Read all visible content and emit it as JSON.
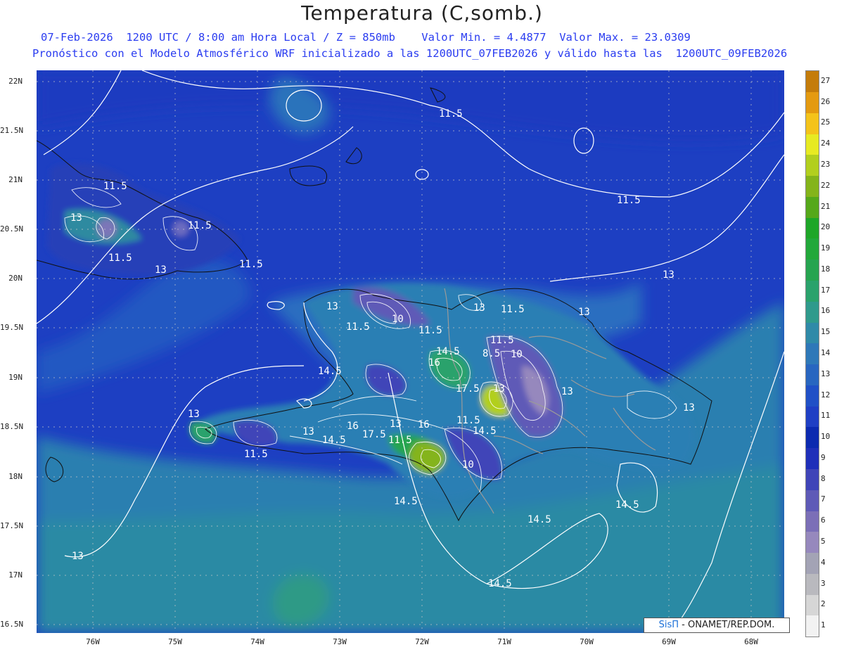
{
  "header": {
    "title": "Temperatura (C,somb.)",
    "line1": "07-Feb-2026  1200 UTC / 8:00 am Hora Local / Z = 850mb    Valor Min. = 4.4877  Valor Max. = 23.0309",
    "line2": "Pronóstico con el Modelo Atmosférico WRF inicializado a las 1200UTC_07FEB2026 y válido hasta las  1200UTC_09FEB2026"
  },
  "axes": {
    "lat_labels": [
      "22N",
      "21.5N",
      "21N",
      "20.5N",
      "20N",
      "19.5N",
      "19N",
      "18.5N",
      "18N",
      "17.5N",
      "17N",
      "16.5N"
    ],
    "lon_labels": [
      "76W",
      "75W",
      "74W",
      "73W",
      "72W",
      "71W",
      "70W",
      "69W",
      "68W"
    ]
  },
  "contour_labels": [
    "11.5",
    "11.5",
    "11.5",
    "11.5",
    "13",
    "11.5",
    "13",
    "11.5",
    "13",
    "13",
    "11.5",
    "13",
    "10",
    "11.5",
    "11.5",
    "13",
    "14.5",
    "16",
    "11.5",
    "8.5",
    "10",
    "14.5",
    "17.5",
    "13",
    "13",
    "13",
    "13",
    "16",
    "17.5",
    "11.5",
    "13",
    "16",
    "11.5",
    "14.5",
    "14.5",
    "10",
    "13",
    "11.5",
    "14.5",
    "14.5",
    "14.5",
    "14.5",
    "13"
  ],
  "legend": {
    "values": [
      "1",
      "2",
      "3",
      "4",
      "5",
      "6",
      "7",
      "8",
      "9",
      "10",
      "11",
      "12",
      "13",
      "14",
      "15",
      "16",
      "17",
      "18",
      "19",
      "20",
      "21",
      "22",
      "23",
      "24",
      "25",
      "26",
      "27"
    ],
    "colors": [
      "#f2f2f2",
      "#d6d6d6",
      "#b9b9be",
      "#a3a3b5",
      "#9688bd",
      "#7b6fb7",
      "#5e5ab7",
      "#3f44b8",
      "#1f2fb9",
      "#0c2ab0",
      "#1f3fc4",
      "#2050c6",
      "#2866c0",
      "#2e78b8",
      "#2f8aa8",
      "#2f9a8c",
      "#2aa26c",
      "#26a450",
      "#22a83a",
      "#1ea628",
      "#55a81a",
      "#84b41a",
      "#b2cf1e",
      "#e7ea22",
      "#f4c31a",
      "#e49a10",
      "#c47c0a"
    ]
  },
  "credit": {
    "brand": "SisΠ",
    "text": "- ONAMET/REP.DOM."
  }
}
